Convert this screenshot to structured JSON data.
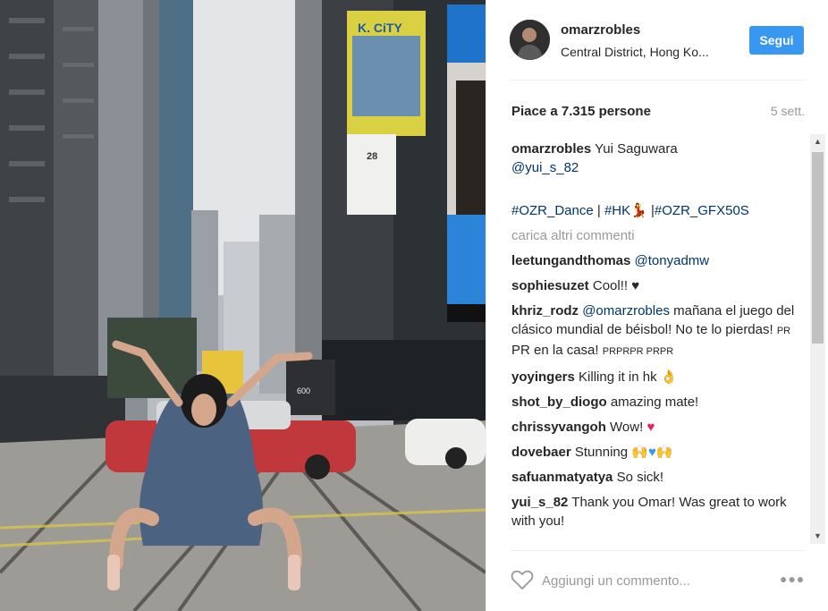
{
  "post": {
    "username": "omarzrobles",
    "location": "Central District, Hong Ko...",
    "follow_label": "Segui",
    "likes_text": "Piace a 7.315 persone",
    "age": "5 sett."
  },
  "photo": {
    "billboard_brand": "K. CiTY",
    "billboard_number": "28",
    "tram_number": "600"
  },
  "caption": {
    "author": "omarzrobles",
    "text": "Yui Saguwara",
    "mention": "@yui_s_82",
    "tag1": "#OZR_Dance",
    "sep": "|",
    "tag2": "#HK",
    "tag3": "#OZR_GFX50S"
  },
  "load_more": "carica altri commenti",
  "comments": [
    {
      "author": "leetungandthomas",
      "mention": "@tonyadmw"
    },
    {
      "author": "sophiesuzet",
      "text": "Cool!!"
    },
    {
      "author": "khriz_rodz",
      "mention": "@omarzrobles",
      "text": "mañana el juego del clásico mundial de béisbol! No te lo pierdas!",
      "small1": "PR",
      "text2": "PR en la casa!",
      "small2": "PRPRPR PRPR"
    },
    {
      "author": "yoyingers",
      "text": "Killing it in hk"
    },
    {
      "author": "shot_by_diogo",
      "text": "amazing mate!"
    },
    {
      "author": "chrissyvangoh",
      "text": "Wow!"
    },
    {
      "author": "dovebaer",
      "text": "Stunning"
    },
    {
      "author": "safuanmatyatya",
      "text": "So sick!"
    },
    {
      "author": "yui_s_82",
      "text": "Thank you Omar! Was great to work with you!"
    }
  ],
  "add_comment": {
    "placeholder": "Aggiungi un commento..."
  },
  "icons": {
    "heart": "heart-outline-icon",
    "more": "more-options-icon",
    "scroll_up": "scroll-up-arrow",
    "scroll_down": "scroll-down-arrow"
  },
  "colors": {
    "accent": "#3897f0",
    "link": "#003569",
    "muted": "#999999",
    "text": "#262626"
  }
}
